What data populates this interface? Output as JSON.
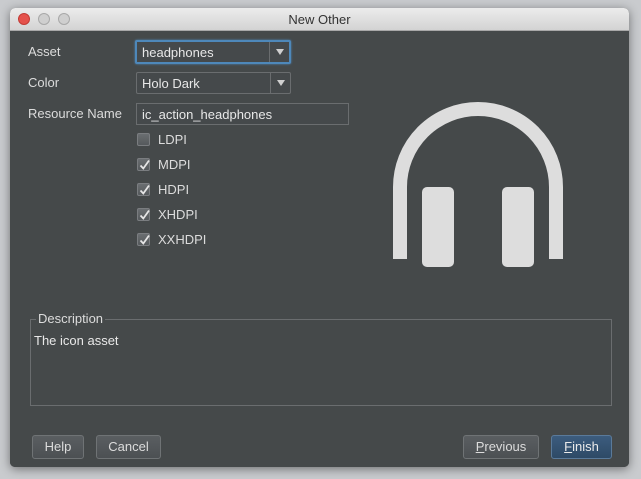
{
  "window": {
    "title": "New Other"
  },
  "form": {
    "asset_label": "Asset",
    "asset_value": "headphones",
    "color_label": "Color",
    "color_value": "Holo Dark",
    "resource_name_label": "Resource Name",
    "resource_name_value": "ic_action_headphones"
  },
  "densities": [
    {
      "label": "LDPI",
      "checked": false
    },
    {
      "label": "MDPI",
      "checked": true
    },
    {
      "label": "HDPI",
      "checked": true
    },
    {
      "label": "XHDPI",
      "checked": true
    },
    {
      "label": "XXHDPI",
      "checked": true
    }
  ],
  "preview": {
    "icon": "headphones-icon",
    "color": "#dddddd"
  },
  "description": {
    "legend": "Description",
    "text": "The icon asset"
  },
  "buttons": {
    "help": "Help",
    "cancel": "Cancel",
    "previous_mnemonic": "P",
    "previous_rest": "revious",
    "finish_mnemonic": "F",
    "finish_rest": "inish"
  },
  "colors": {
    "background": "#45494a",
    "focus": "#4e88ba",
    "primary_button": "#2e4a66"
  }
}
